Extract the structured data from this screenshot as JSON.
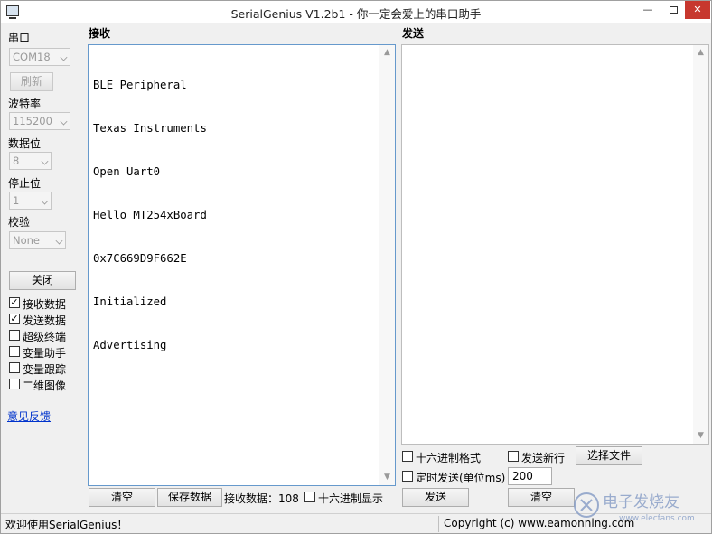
{
  "window": {
    "title": "SerialGenius V1.2b1 - 你一定会爱上的串口助手",
    "minimize_glyph": "—",
    "close_glyph": "✕"
  },
  "settings": {
    "port_label": "串口",
    "port_value": "COM18",
    "refresh_label": "刷新",
    "baud_label": "波特率",
    "baud_value": "115200",
    "databits_label": "数据位",
    "databits_value": "8",
    "stopbits_label": "停止位",
    "stopbits_value": "1",
    "parity_label": "校验",
    "parity_value": "None",
    "close_label": "关闭",
    "options": [
      {
        "label": "接收数据",
        "checked": true
      },
      {
        "label": "发送数据",
        "checked": true
      },
      {
        "label": "超级终端",
        "checked": false
      },
      {
        "label": "变量助手",
        "checked": false
      },
      {
        "label": "变量跟踪",
        "checked": false
      },
      {
        "label": "二维图像",
        "checked": false
      }
    ],
    "feedback_label": "意见反馈",
    "check_glyph": "✓"
  },
  "receive": {
    "title": "接收",
    "lines": [
      "BLE Peripheral",
      "Texas Instruments",
      "Open Uart0",
      "Hello MT254xBoard",
      "0x7C669D9F662E",
      "Initialized",
      "Advertising"
    ],
    "clear_label": "清空",
    "save_label": "保存数据",
    "count_label": "接收数据：",
    "count_value": "108",
    "hex_display_label": "十六进制显示",
    "hex_display_checked": false
  },
  "send": {
    "title": "发送",
    "hex_format_label": "十六进制格式",
    "newline_label": "发送新行",
    "choose_file_label": "选择文件",
    "timed_send_label": "定时发送(单位ms)",
    "interval_value": "200",
    "send_label": "发送",
    "clear_label": "清空"
  },
  "status": {
    "welcome": "欢迎使用SerialGenius！",
    "copyright": "Copyright (c) www.eamonning.com"
  },
  "watermark": {
    "text": "电子发烧友",
    "url": "www.elecfans.com"
  },
  "colors": {
    "accent": "#0033cc",
    "close_button": "#c7372e",
    "watermark": "#8aa0c8"
  }
}
